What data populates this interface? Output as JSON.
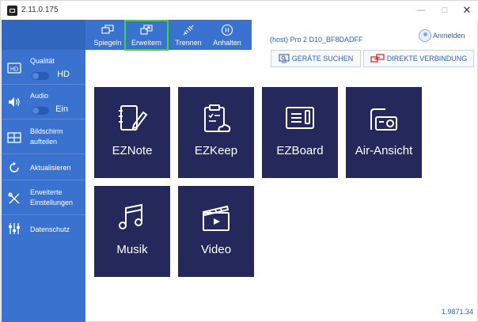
{
  "titlebar": {
    "version": "2.11.0.175",
    "minimize": "—",
    "maximize": "□",
    "close": "✕"
  },
  "toolbar": {
    "items": [
      {
        "label": "Spiegeln",
        "icon": "mirror-icon"
      },
      {
        "label": "Erweitern",
        "icon": "extend-icon",
        "active": true
      },
      {
        "label": "Trennen",
        "icon": "disconnect-icon"
      },
      {
        "label": "Anhalten",
        "icon": "pause-icon"
      }
    ]
  },
  "sidebar": {
    "quality": {
      "label": "Qualität",
      "value": "HD"
    },
    "audio": {
      "label": "Audio",
      "value": "Ein"
    },
    "split": {
      "label_line1": "Bildschirm",
      "label_line2": "aufteilen"
    },
    "refresh": {
      "label": "Aktualisieren"
    },
    "advanced": {
      "label_line1": "Erweiterte",
      "label_line2": "Einstellungen"
    },
    "privacy": {
      "label": "Datenschutz"
    }
  },
  "header": {
    "host": "(host) Pro 2 D10_BF8DADFF",
    "login": "Anmelden",
    "search_devices": "GERÄTE SUCHEN",
    "direct_connect": "DIREKTE VERBINDUNG"
  },
  "tiles": [
    {
      "name": "EZNote",
      "icon": "notebook-pen-icon"
    },
    {
      "name": "EZKeep",
      "icon": "clipboard-cloud-icon"
    },
    {
      "name": "EZBoard",
      "icon": "whiteboard-icon"
    },
    {
      "name": "Air-Ansicht",
      "icon": "projector-icon"
    },
    {
      "name": "Musik",
      "icon": "music-note-icon"
    },
    {
      "name": "Video",
      "icon": "clapperboard-icon"
    }
  ],
  "footer": {
    "build": "1.9871.34"
  },
  "colors": {
    "sidebar": "#3a73cf",
    "tile": "#25285a",
    "accent_text": "#2f5fb8",
    "active_outline": "#3fd43f",
    "direct_icon": "#e02a2a"
  }
}
